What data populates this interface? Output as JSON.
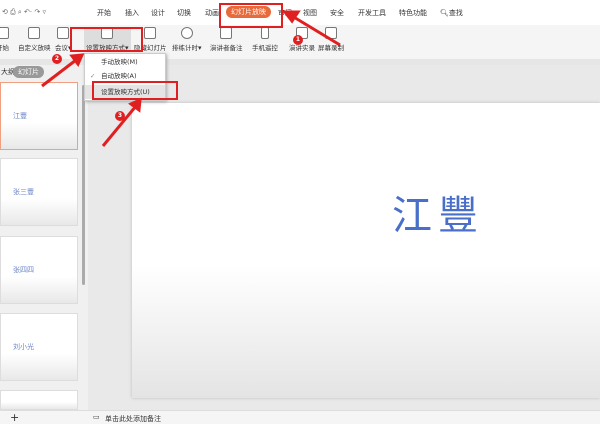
{
  "tabs": [
    "开始",
    "插入",
    "设计",
    "切换",
    "动画",
    "幻灯片放映",
    "审阅",
    "视图",
    "安全",
    "开发工具",
    "特色功能",
    "查找"
  ],
  "ribbon": [
    "开始",
    "自定义放映",
    "会议",
    "设置放映方式",
    "隐藏幻灯片",
    "排练计时",
    "演讲者备注",
    "手机遥控",
    "演讲实录",
    "屏幕录制"
  ],
  "menu": {
    "items": [
      "手动放映(M)",
      "自动放映(A)",
      "设置放映方式(U)"
    ],
    "checked_index": 1
  },
  "panel": {
    "outline": "大纲",
    "slides_tab": "幻灯片",
    "add": "+"
  },
  "slides": [
    "江豐",
    "张三豐",
    "张四四",
    "刘小光",
    ""
  ],
  "main_slide_text": "江豐",
  "status": {
    "notes": "单击此处添加备注"
  },
  "annotations": [
    "1",
    "2",
    "3"
  ],
  "colors": {
    "accent": "#e8693a",
    "annotation": "#e02020"
  }
}
